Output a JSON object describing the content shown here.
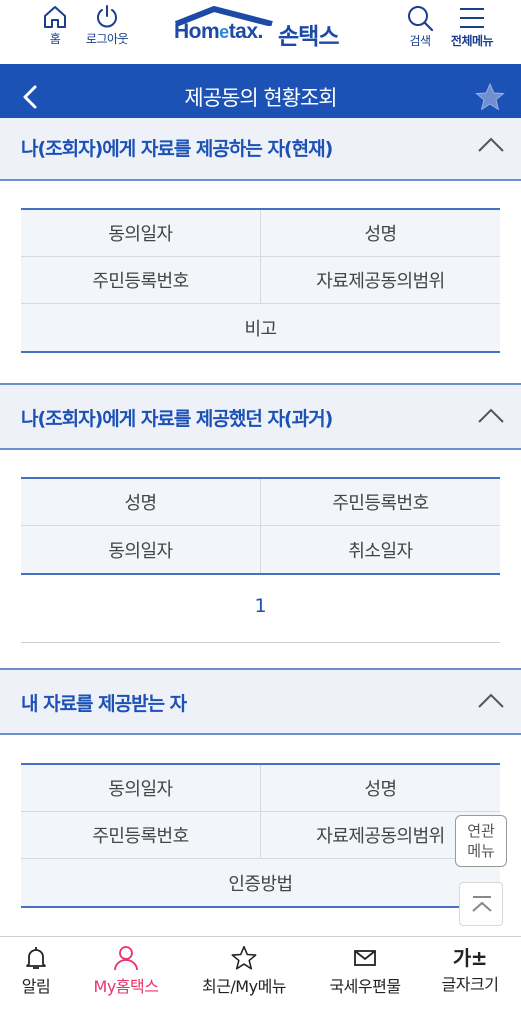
{
  "header": {
    "home_label": "홈",
    "logout_label": "로그아웃",
    "logo_text_pre": "Hom",
    "logo_text_e": "e",
    "logo_text_post": "tax.",
    "logo_brand": "손택스",
    "search_label": "검색",
    "menu_label": "전체메뉴"
  },
  "titlebar": {
    "title": "제공동의 현황조회"
  },
  "sections": [
    {
      "title": "나(조회자)에게 자료를 제공하는 자(현재)",
      "rows": [
        [
          "동의일자",
          "성명"
        ],
        [
          "주민등록번호",
          "자료제공동의범위"
        ],
        [
          "비고"
        ]
      ]
    },
    {
      "title": "나(조회자)에게 자료를 제공했던 자(과거)",
      "rows": [
        [
          "성명",
          "주민등록번호"
        ],
        [
          "동의일자",
          "취소일자"
        ]
      ],
      "page": "1"
    },
    {
      "title": "내 자료를 제공받는 자",
      "rows": [
        [
          "동의일자",
          "성명"
        ],
        [
          "주민등록번호",
          "자료제공동의범위"
        ],
        [
          "인증방법"
        ]
      ]
    }
  ],
  "floating": {
    "related_line1": "연관",
    "related_line2": "메뉴"
  },
  "bottomnav": {
    "alarm": "알림",
    "my_hometax": "My홈택스",
    "recent": "최근/My메뉴",
    "mail": "국세우편물",
    "font_icon": "가±",
    "font": "글자크기"
  },
  "colors": {
    "brand_blue": "#1c51b5",
    "active_pink": "#e8356b",
    "table_bg": "#f2f5fa"
  }
}
